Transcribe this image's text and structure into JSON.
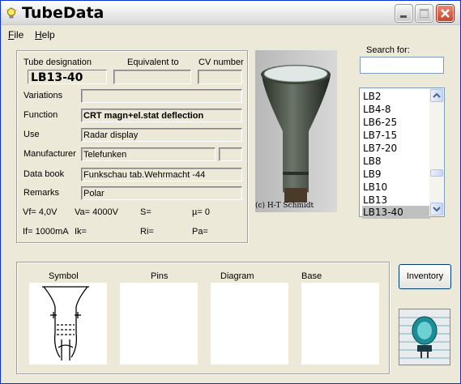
{
  "app": {
    "title": "TubeData"
  },
  "menu": {
    "items": [
      {
        "mnemonic": "F",
        "rest": "ile"
      },
      {
        "mnemonic": "H",
        "rest": "elp"
      }
    ]
  },
  "details": {
    "designation_label": "Tube designation",
    "designation": "LB13-40",
    "equivalent_label": "Equivalent to",
    "equivalent": "",
    "cv_label": "CV number",
    "cv": "",
    "variations_label": "Variations",
    "variations": "",
    "function_label": "Function",
    "function": "CRT magn+el.stat deflection",
    "use_label": "Use",
    "use": "Radar display",
    "manufacturer_label": "Manufacturer",
    "manufacturer": "Telefunken",
    "manufacturer_extra": "",
    "databook_label": "Data book",
    "databook": "Funkschau tab.Wehrmacht -44",
    "remarks_label": "Remarks",
    "remarks": "Polar"
  },
  "params": {
    "vf": "Vf= 4,0V",
    "va": "Va= 4000V",
    "s": "S=",
    "mu": "µ=   0",
    "if": "If= 1000mA",
    "ik": "Ik=",
    "ri": "Ri=",
    "pa": "Pa="
  },
  "photo": {
    "credit": "(c) H-T Schmidt"
  },
  "search": {
    "label": "Search for:",
    "value": ""
  },
  "tube_list": {
    "items": [
      "LB2",
      "LB4-8",
      "LB6-25",
      "LB7-15",
      "LB7-20",
      "LB8",
      "LB9",
      "LB10",
      "LB13",
      "LB13-40"
    ],
    "selected_index": 9,
    "scroll_position": 0.63
  },
  "panels": {
    "symbol": "Symbol",
    "pins": "Pins",
    "diagram": "Diagram",
    "base": "Base"
  },
  "buttons": {
    "inventory": "Inventory"
  },
  "colors": {
    "selection": "#c0c0c0",
    "close_button": "#c8452a",
    "window_bg": "#ece9d8"
  }
}
